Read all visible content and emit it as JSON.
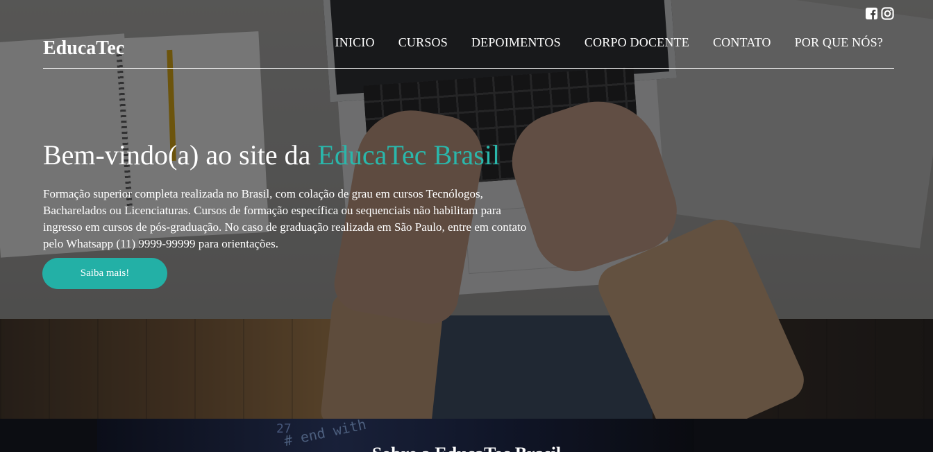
{
  "header": {
    "brand": "EducaTec",
    "social": [
      {
        "icon": "facebook-square-icon",
        "label": "Facebook"
      },
      {
        "icon": "instagram-icon",
        "label": "Instagram"
      }
    ],
    "nav": [
      {
        "label": "INICIO"
      },
      {
        "label": "CURSOS"
      },
      {
        "label": "DEPOIMENTOS"
      },
      {
        "label": "CORPO DOCENTE"
      },
      {
        "label": "CONTATO"
      },
      {
        "label": "POR QUE NÓS?"
      }
    ]
  },
  "hero": {
    "headline_prefix": "Bem-vindo(a) ao site da ",
    "headline_accent": "EducaTec Brasil",
    "lead": "Formação superior completa realizada no Brasil, com colação de grau em cursos Tecnólogos, Bacharelados ou Licenciaturas. Cursos de formação específica ou sequenciais não habilitam para ingresso em cursos de pós-graduação. No caso de graduação realizada em São Paulo, entre em contato pelo Whatsapp (11) 9999-99999 para orientações.",
    "cta_label": "Saiba mais!"
  },
  "section2": {
    "title_partial": "Sobre a EducaTec Brasil",
    "code_number": "27",
    "code_text": "# end with"
  },
  "colors": {
    "accent": "#2ab7ab",
    "button": "#23b0a6"
  }
}
